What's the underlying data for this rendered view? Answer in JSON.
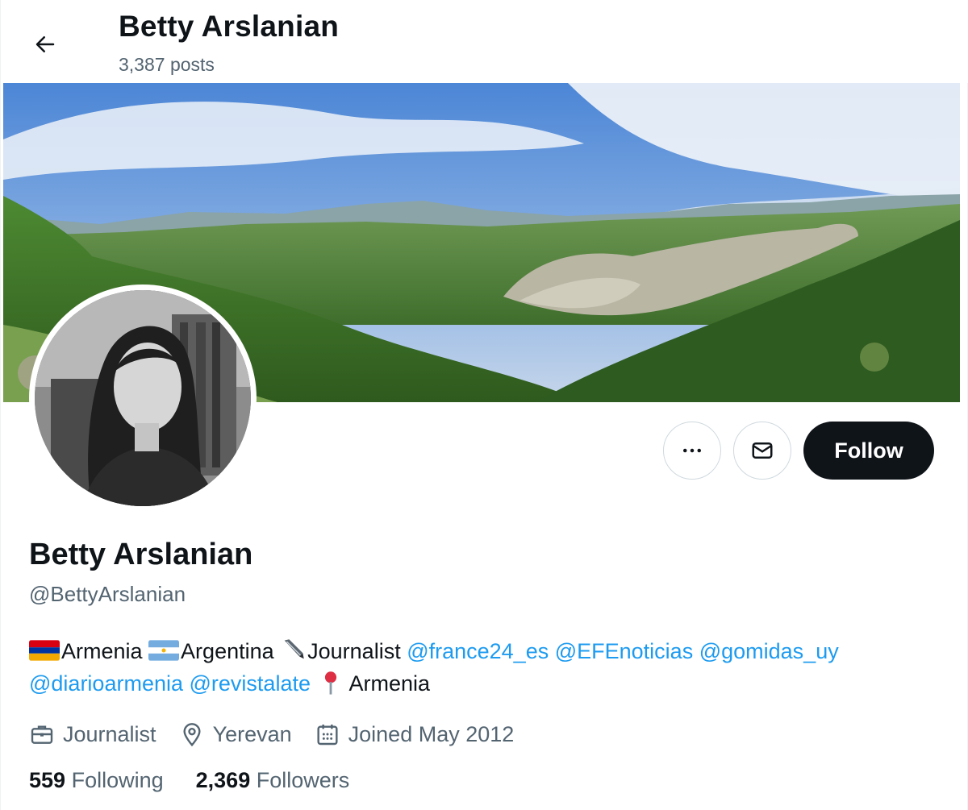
{
  "header": {
    "title": "Betty Arslanian",
    "posts": "3,387 posts"
  },
  "profile": {
    "name": "Betty Arslanian",
    "handle": "@BettyArslanian",
    "follow_label": "Follow"
  },
  "bio": {
    "country1": "Armenia ",
    "country2": "Argentina ",
    "role": "Journalist ",
    "mentions": [
      "@france24_es",
      "@EFEnoticias",
      "@gomidas_uy",
      "@diarioarmenia",
      "@revistalate"
    ],
    "location_text": " Armenia"
  },
  "meta": {
    "profession": "Journalist",
    "location": "Yerevan",
    "joined": "Joined May 2012"
  },
  "stats": {
    "following_count": "559",
    "following_label": "Following",
    "followers_count": "2,369",
    "followers_label": "Followers"
  },
  "colors": {
    "accent": "#1d9bf0",
    "text": "#0f1419",
    "secondary": "#536471",
    "follow_bg": "#0f1419"
  },
  "icons": [
    "back-arrow-icon",
    "more-icon",
    "envelope-icon",
    "briefcase-icon",
    "location-pin-icon",
    "calendar-icon"
  ]
}
